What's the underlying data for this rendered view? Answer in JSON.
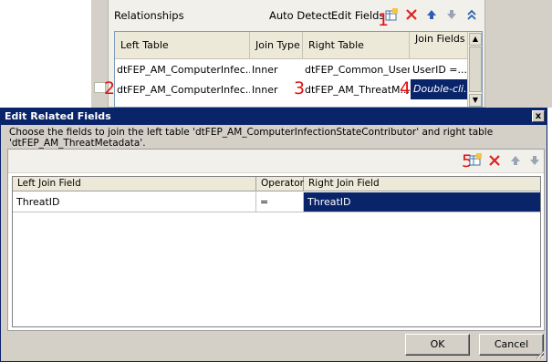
{
  "relationships": {
    "title": "Relationships",
    "toolbar": {
      "auto_detect": "Auto Detect",
      "edit_fields": "Edit Fields"
    },
    "columns": [
      "Left Table",
      "Join Type",
      "Right Table",
      "Join Fields"
    ],
    "rows": [
      {
        "left": "dtFEP_AM_ComputerInfec...",
        "join": "Inner",
        "right": "dtFEP_Common_User",
        "fields": "UserID =..."
      },
      {
        "left": "dtFEP_AM_ComputerInfec...",
        "join": "Inner",
        "right": "dtFEP_AM_ThreatM...",
        "fields": "Double-cli..."
      }
    ]
  },
  "annotations": [
    "1",
    "2",
    "3",
    "4",
    "5"
  ],
  "annotation_color": "#e01010",
  "dialog": {
    "title": "Edit Related Fields",
    "close_glyph": "x",
    "description": "Choose the fields to join the left table 'dtFEP_AM_ComputerInfectionStateContributor' and right table 'dtFEP_AM_ThreatMetadata'.",
    "columns": [
      "Left Join Field",
      "Operator",
      "Right Join Field"
    ],
    "rows": [
      {
        "left": "ThreatID",
        "operator": "=",
        "right": "ThreatID"
      }
    ],
    "ok_label": "OK",
    "cancel_label": "Cancel"
  },
  "colors": {
    "title_bar": "#0a246a",
    "selection": "#0a246a",
    "dialog_face": "#d4d0c8"
  },
  "icons": [
    "add-relationship-icon",
    "delete-icon",
    "move-up-icon",
    "move-down-icon",
    "collapse-icon",
    "add-field-icon",
    "remove-field-icon",
    "field-up-icon",
    "field-down-icon"
  ]
}
